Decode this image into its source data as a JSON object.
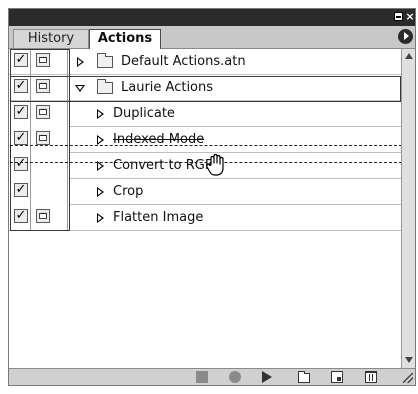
{
  "panel": {
    "tabs": [
      "History",
      "Actions"
    ],
    "active_tab": "Actions"
  },
  "rows": [
    {
      "label": "Default Actions.atn",
      "checked": true,
      "dialog": true,
      "type": "set",
      "expanded": false
    },
    {
      "label": "Laurie Actions",
      "checked": true,
      "dialog": true,
      "type": "set",
      "expanded": true
    },
    {
      "label": "Duplicate",
      "checked": true,
      "dialog": true,
      "type": "action"
    },
    {
      "label": "Indexed Mode",
      "checked": true,
      "dialog": true,
      "type": "action",
      "dragging": true
    },
    {
      "label": "Convert to RGB",
      "checked": true,
      "dialog": false,
      "type": "action"
    },
    {
      "label": "Crop",
      "checked": true,
      "dialog": false,
      "type": "action"
    },
    {
      "label": "Flatten Image",
      "checked": true,
      "dialog": true,
      "type": "action"
    }
  ],
  "toolbar": {
    "buttons": [
      "stop-icon",
      "record-icon",
      "play-icon",
      "new-set-icon",
      "new-action-icon",
      "trash-icon"
    ]
  }
}
